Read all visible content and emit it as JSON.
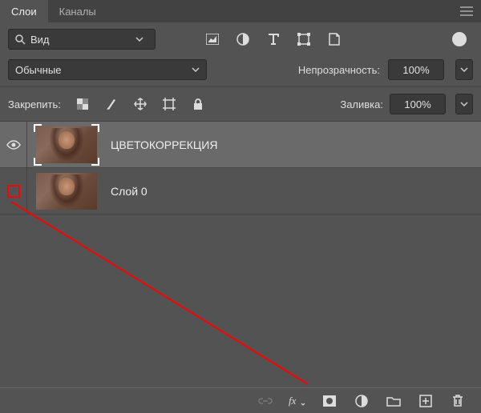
{
  "tabs": {
    "layers": "Слои",
    "channels": "Каналы"
  },
  "search": {
    "value": "Вид"
  },
  "blend_mode": "Обычные",
  "opacity": {
    "label": "Непрозрачность:",
    "value": "100%"
  },
  "lock": {
    "label": "Закрепить:"
  },
  "fill": {
    "label": "Заливка:",
    "value": "100%"
  },
  "layers": [
    {
      "name": "ЦВЕТОКОРРЕКЦИЯ",
      "visible": true,
      "selected": true
    },
    {
      "name": "Слой 0",
      "visible": false,
      "selected": false
    }
  ]
}
